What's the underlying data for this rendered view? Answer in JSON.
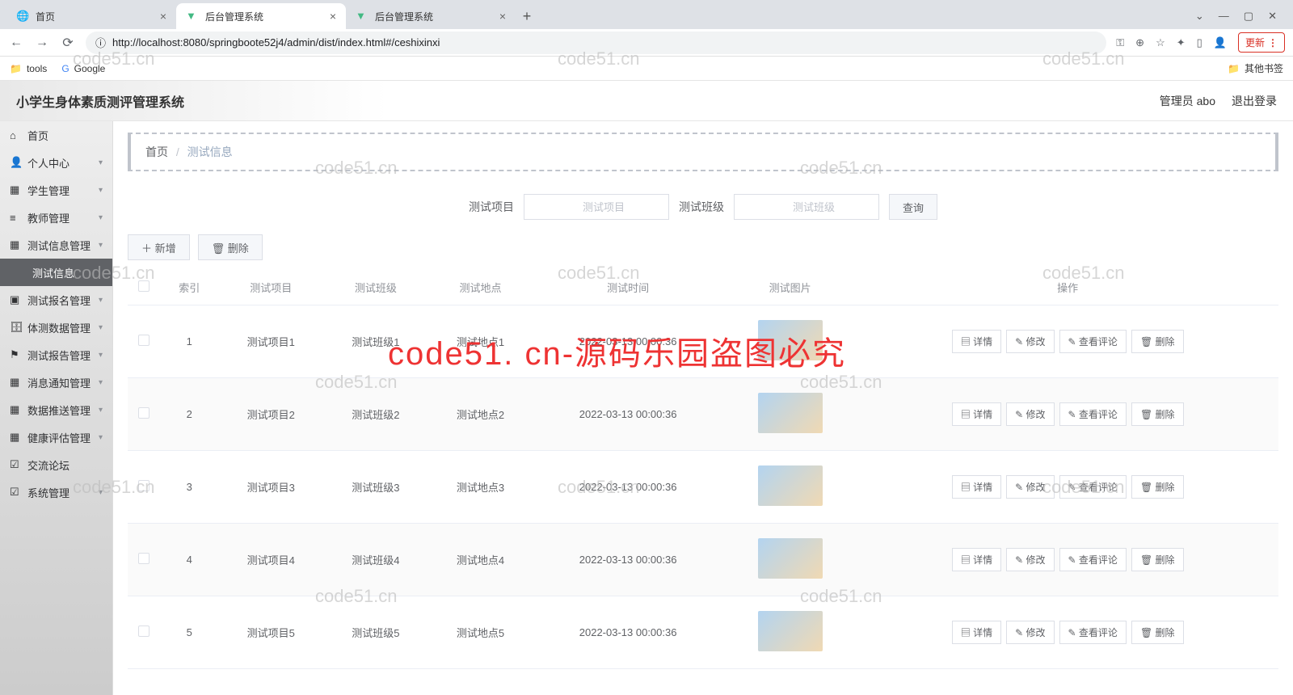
{
  "browser": {
    "tabs": [
      {
        "title": "首页",
        "active": false
      },
      {
        "title": "后台管理系统",
        "active": true
      },
      {
        "title": "后台管理系统",
        "active": false
      }
    ],
    "url": "http://localhost:8080/springboote52j4/admin/dist/index.html#/ceshixinxi",
    "update_btn": "更新",
    "bookmarks": {
      "tools": "tools",
      "google": "Google",
      "other": "其他书签"
    }
  },
  "header": {
    "title": "小学生身体素质测评管理系统",
    "user": "管理员 abo",
    "logout": "退出登录"
  },
  "sidebar": {
    "items": [
      {
        "icon": "⌂",
        "label": "首页"
      },
      {
        "icon": "👤",
        "label": "个人中心",
        "expand": true
      },
      {
        "icon": "▦",
        "label": "学生管理",
        "expand": true
      },
      {
        "icon": "≡",
        "label": "教师管理",
        "expand": true
      },
      {
        "icon": "▦",
        "label": "测试信息管理",
        "expand": true
      },
      {
        "icon": "",
        "label": "测试信息",
        "active": true
      },
      {
        "icon": "▣",
        "label": "测试报名管理",
        "expand": true
      },
      {
        "icon": "🗄",
        "label": "体测数据管理",
        "expand": true
      },
      {
        "icon": "⚑",
        "label": "测试报告管理",
        "expand": true
      },
      {
        "icon": "▦",
        "label": "消息通知管理",
        "expand": true
      },
      {
        "icon": "▦",
        "label": "数据推送管理",
        "expand": true
      },
      {
        "icon": "▦",
        "label": "健康评估管理",
        "expand": true
      },
      {
        "icon": "☑",
        "label": "交流论坛"
      },
      {
        "icon": "☑",
        "label": "系统管理",
        "expand": true
      }
    ]
  },
  "breadcrumb": {
    "home": "首页",
    "current": "测试信息"
  },
  "search": {
    "label1": "测试项目",
    "ph1": "测试项目",
    "label2": "测试班级",
    "ph2": "测试班级",
    "btn": "查询"
  },
  "toolbar": {
    "add": "新增",
    "del": "删除"
  },
  "table": {
    "cols": [
      "",
      "索引",
      "测试项目",
      "测试班级",
      "测试地点",
      "测试时间",
      "测试图片",
      "操作"
    ],
    "ops": {
      "detail": "详情",
      "edit": "修改",
      "comment": "查看评论",
      "del": "删除"
    },
    "rows": [
      {
        "idx": "1",
        "proj": "测试项目1",
        "cls": "测试班级1",
        "loc": "测试地点1",
        "time": "2022-03-13 00:00:36"
      },
      {
        "idx": "2",
        "proj": "测试项目2",
        "cls": "测试班级2",
        "loc": "测试地点2",
        "time": "2022-03-13 00:00:36"
      },
      {
        "idx": "3",
        "proj": "测试项目3",
        "cls": "测试班级3",
        "loc": "测试地点3",
        "time": "2022-03-13 00:00:36"
      },
      {
        "idx": "4",
        "proj": "测试项目4",
        "cls": "测试班级4",
        "loc": "测试地点4",
        "time": "2022-03-13 00:00:36"
      },
      {
        "idx": "5",
        "proj": "测试项目5",
        "cls": "测试班级5",
        "loc": "测试地点5",
        "time": "2022-03-13 00:00:36"
      }
    ]
  },
  "watermark": {
    "light": "code51.cn",
    "red": "code51. cn-源码乐园盗图必究"
  }
}
